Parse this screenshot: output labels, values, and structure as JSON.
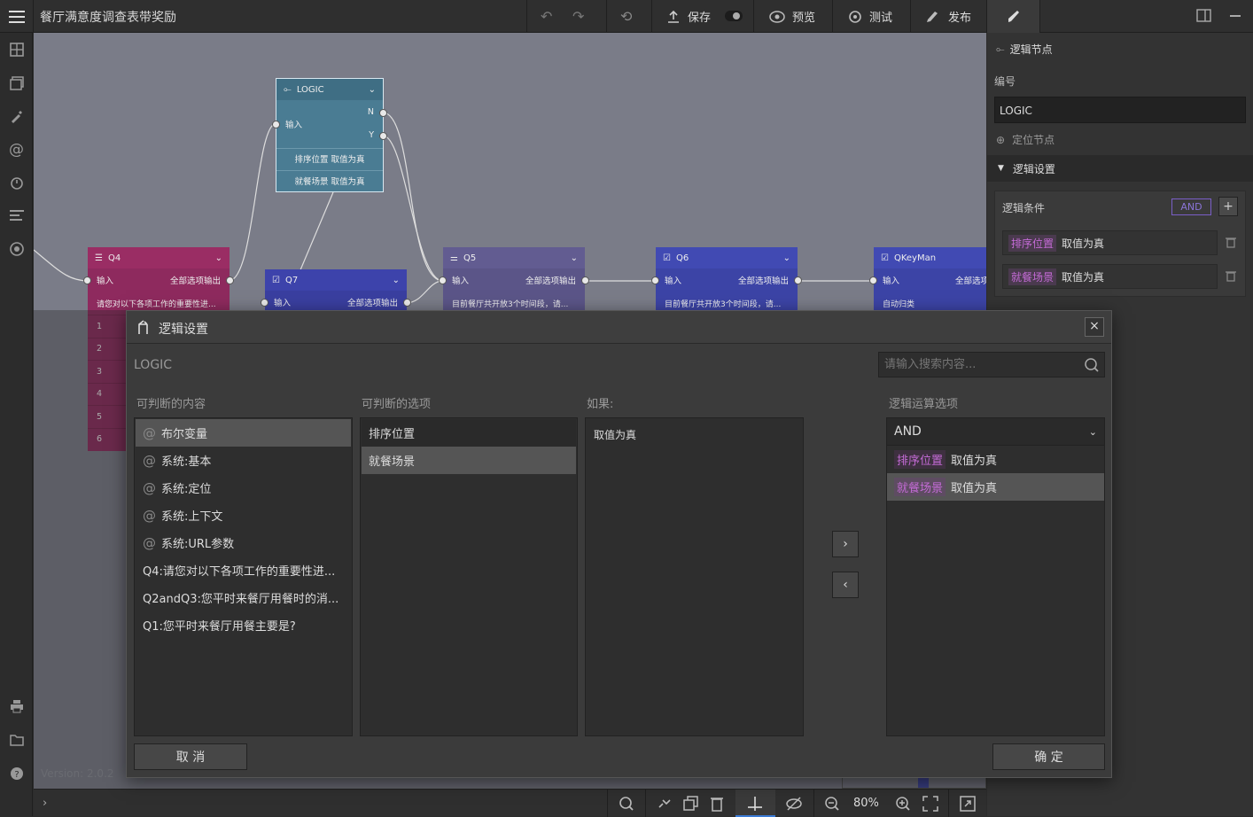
{
  "app": {
    "title": "餐厅满意度调查表带奖励",
    "version": "Version: 2.0.2"
  },
  "toolbar": {
    "save": "保存",
    "preview": "预览",
    "test": "测试",
    "publish": "发布"
  },
  "nodes": {
    "logic": {
      "title": "LOGIC",
      "input": "输入",
      "n": "N",
      "y": "Y",
      "cond1": "排序位置 取值为真",
      "cond2": "就餐场景 取值为真"
    },
    "q4": {
      "title": "Q4",
      "input": "输入",
      "output": "全部选项输出",
      "text": "请您对以下各项工作的重要性进...",
      "rows": [
        "1",
        "2",
        "3",
        "4",
        "5",
        "6"
      ]
    },
    "q7": {
      "title": "Q7",
      "input": "输入",
      "output": "全部选项输出"
    },
    "q5": {
      "title": "Q5",
      "input": "输入",
      "output": "全部选项输出",
      "text": "目前餐厅共开放3个时间段，请..."
    },
    "q6": {
      "title": "Q6",
      "input": "输入",
      "output": "全部选项输出",
      "text": "目前餐厅共开放3个时间段，请..."
    },
    "qkeyman": {
      "title": "QKeyMan",
      "input": "输入",
      "output": "全部选项",
      "text": "自动归类"
    }
  },
  "right_panel": {
    "header": "逻辑节点",
    "id_label": "编号",
    "id_value": "LOGIC",
    "locate": "定位节点",
    "section": "逻辑设置",
    "cond_label": "逻辑条件",
    "and": "AND",
    "conditions": [
      {
        "tag": "排序位置",
        "value": "取值为真"
      },
      {
        "tag": "就餐场景",
        "value": "取值为真"
      }
    ]
  },
  "dialog": {
    "title": "逻辑设置",
    "node_name": "LOGIC",
    "search_placeholder": "请输入搜索内容...",
    "col1_label": "可判断的内容",
    "col2_label": "可判断的选项",
    "col3_label": "如果:",
    "col4_label": "逻辑运算选项",
    "content_items": [
      {
        "at": "@",
        "label": "布尔变量"
      },
      {
        "at": "@",
        "label": "系统:基本"
      },
      {
        "at": "@",
        "label": "系统:定位"
      },
      {
        "at": "@",
        "label": "系统:上下文"
      },
      {
        "at": "@",
        "label": "系统:URL参数"
      },
      {
        "at": "",
        "label": "Q4:请您对以下各项工作的重要性进..."
      },
      {
        "at": "",
        "label": "Q2andQ3:您平时来餐厅用餐时的消..."
      },
      {
        "at": "",
        "label": "Q1:您平时来餐厅用餐主要是?"
      }
    ],
    "option_items": [
      "排序位置",
      "就餐场景"
    ],
    "if_items": [
      "取值为真"
    ],
    "operator": "AND",
    "logic_items": [
      {
        "tag": "排序位置",
        "value": "取值为真"
      },
      {
        "tag": "就餐场景",
        "value": "取值为真"
      }
    ],
    "cancel": "取 消",
    "confirm": "确 定"
  },
  "bottom": {
    "zoom": "80%"
  },
  "colors": {
    "q4": "#8e2a5e",
    "q7": "#3a3fa0",
    "q5": "#5b5588",
    "q6": "#3c44a6",
    "logic": "#4a7c93",
    "tag": "#c46bd6"
  }
}
